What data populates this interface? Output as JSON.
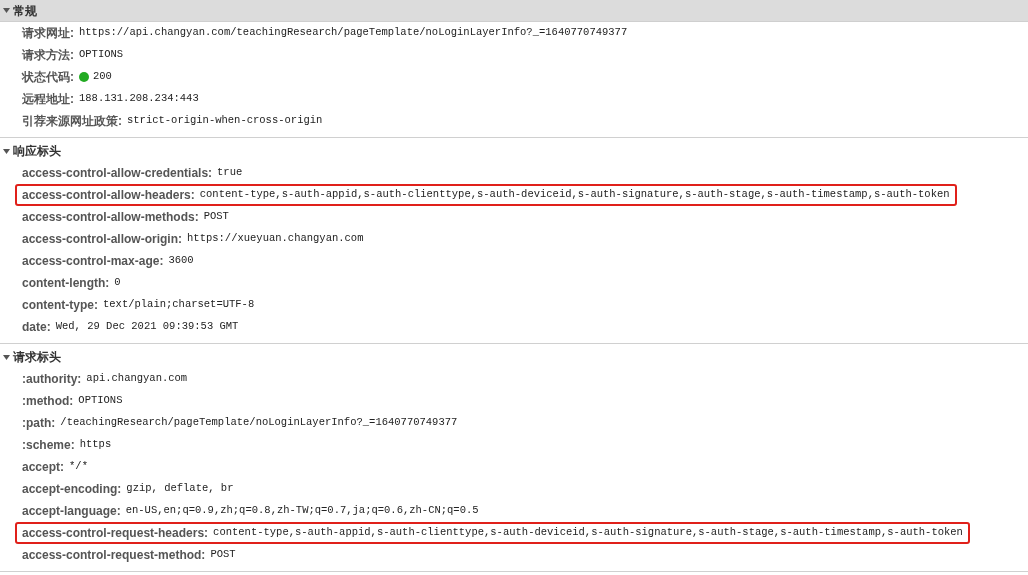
{
  "sections": [
    {
      "title": "常规",
      "expanded": true,
      "shaded": true,
      "rows": [
        {
          "key": "请求网址:",
          "value": "https://api.changyan.com/teachingResearch/pageTemplate/noLoginLayerInfo?_=1640770749377",
          "highlighted": false
        },
        {
          "key": "请求方法:",
          "value": "OPTIONS",
          "highlighted": false
        },
        {
          "key": "状态代码:",
          "value": "200",
          "color": "#22aa22",
          "highlighted": false
        },
        {
          "key": "远程地址:",
          "value": "188.131.208.234:443",
          "highlighted": false
        },
        {
          "key": "引荐来源网址政策:",
          "value": "strict-origin-when-cross-origin",
          "highlighted": false
        }
      ]
    },
    {
      "title": "响应标头",
      "expanded": true,
      "shaded": false,
      "rows": [
        {
          "key": "access-control-allow-credentials:",
          "value": "true",
          "highlighted": false
        },
        {
          "key": "access-control-allow-headers:",
          "value": "content-type,s-auth-appid,s-auth-clienttype,s-auth-deviceid,s-auth-signature,s-auth-stage,s-auth-timestamp,s-auth-token",
          "highlighted": true
        },
        {
          "key": "access-control-allow-methods:",
          "value": "POST",
          "highlighted": false
        },
        {
          "key": "access-control-allow-origin:",
          "value": "https://xueyuan.changyan.com",
          "highlighted": false
        },
        {
          "key": "access-control-max-age:",
          "value": "3600",
          "highlighted": false
        },
        {
          "key": "content-length:",
          "value": "0",
          "highlighted": false
        },
        {
          "key": "content-type:",
          "value": "text/plain;charset=UTF-8",
          "highlighted": false
        },
        {
          "key": "date:",
          "value": "Wed, 29 Dec 2021 09:39:53 GMT",
          "highlighted": false
        }
      ]
    },
    {
      "title": "请求标头",
      "expanded": true,
      "shaded": false,
      "rows": [
        {
          "key": ":authority:",
          "value": "api.changyan.com",
          "highlighted": false
        },
        {
          "key": ":method:",
          "value": "OPTIONS",
          "highlighted": false
        },
        {
          "key": ":path:",
          "value": "/teachingResearch/pageTemplate/noLoginLayerInfo?_=1640770749377",
          "highlighted": false
        },
        {
          "key": ":scheme:",
          "value": "https",
          "highlighted": false
        },
        {
          "key": "accept:",
          "value": "*/*",
          "highlighted": false
        },
        {
          "key": "accept-encoding:",
          "value": "gzip, deflate, br",
          "highlighted": false
        },
        {
          "key": "accept-language:",
          "value": "en-US,en;q=0.9,zh;q=0.8,zh-TW;q=0.7,ja;q=0.6,zh-CN;q=0.5",
          "highlighted": false
        },
        {
          "key": "access-control-request-headers:",
          "value": "content-type,s-auth-appid,s-auth-clienttype,s-auth-deviceid,s-auth-signature,s-auth-stage,s-auth-timestamp,s-auth-token",
          "highlighted": true
        },
        {
          "key": "access-control-request-method:",
          "value": "POST",
          "highlighted": false
        }
      ]
    }
  ]
}
